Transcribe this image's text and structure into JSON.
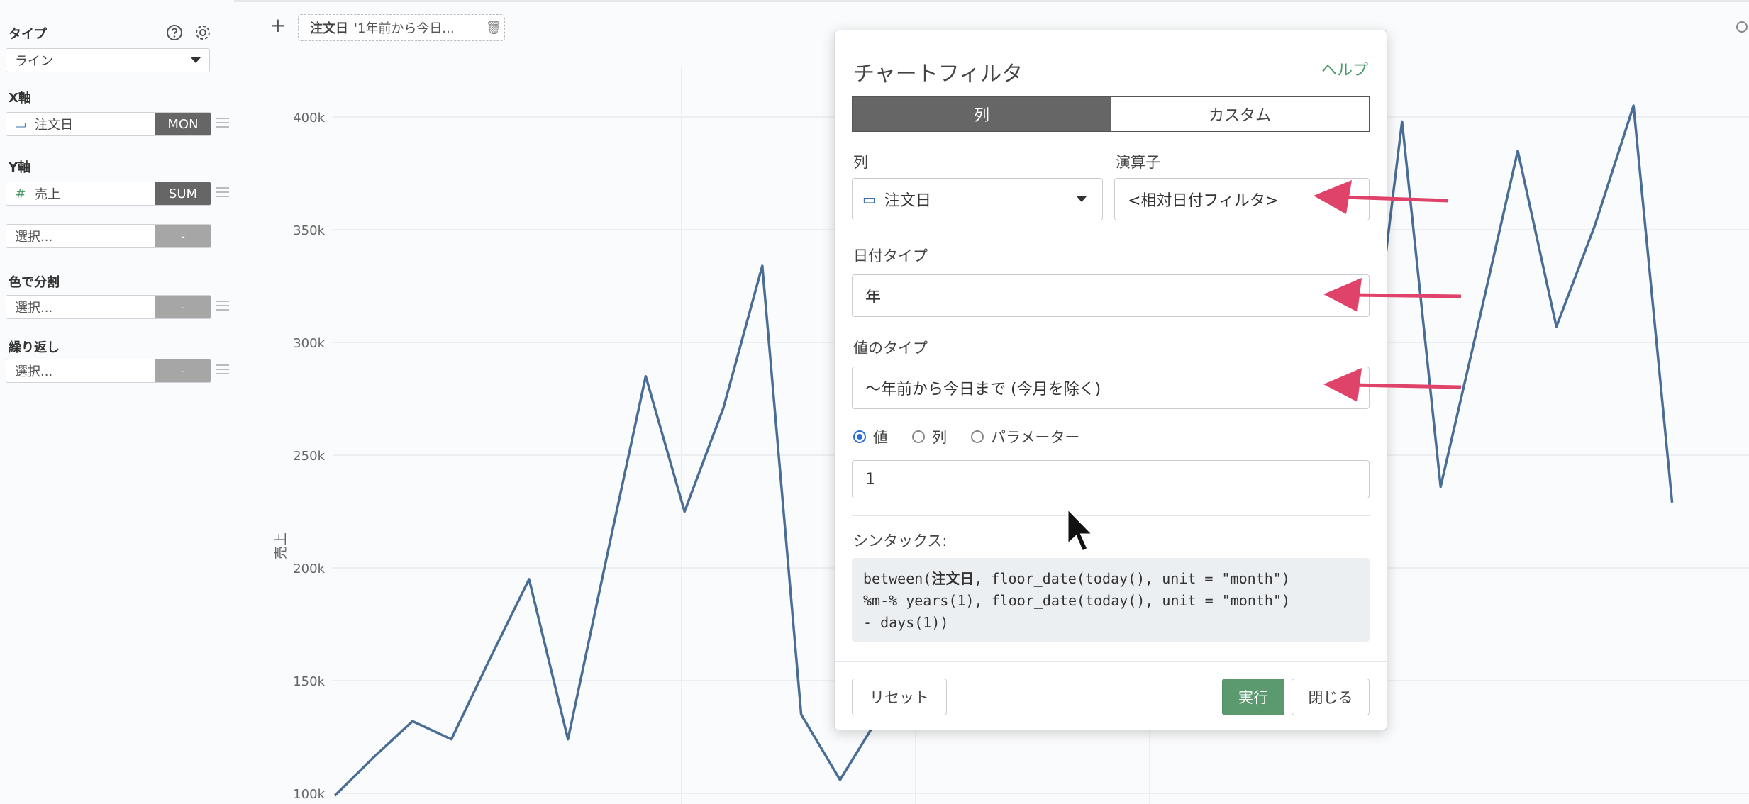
{
  "sidebar": {
    "type_label": "タイプ",
    "type_value": "ライン",
    "x_axis_label": "X軸",
    "x_field": {
      "name": "注文日",
      "agg": "MON"
    },
    "y_axis_label": "Y軸",
    "y_field": {
      "name": "売上",
      "agg": "SUM"
    },
    "y_extra": {
      "placeholder": "選択...",
      "agg": "-"
    },
    "color_label": "色で分割",
    "color_select": {
      "placeholder": "選択...",
      "agg": "-"
    },
    "repeat_label": "繰り返し",
    "repeat_select": {
      "placeholder": "選択...",
      "agg": "-"
    },
    "icons": [
      "help-icon",
      "gear-icon",
      "calendar-icon",
      "hash-icon",
      "hamburger-icon"
    ]
  },
  "toolbar": {
    "filter_chip": {
      "field": "注文日",
      "value": "'1年前から今日..."
    }
  },
  "chart_data": {
    "type": "line",
    "ylabel": "売上",
    "yticks": [
      "100k",
      "150k",
      "200k",
      "250k",
      "300k",
      "350k",
      "400k"
    ],
    "ylim": [
      100000,
      400000
    ],
    "line_color": "#4a6d96",
    "grid": true,
    "series": [
      {
        "values": [
          99000,
          116000,
          132000,
          124000,
          160000,
          195000,
          124000,
          205000,
          285000,
          225000,
          271000,
          334000,
          135000,
          106000,
          134000
        ]
      },
      {
        "values": [
          190000,
          258000,
          398000,
          236000,
          310000,
          385000,
          307000,
          352000,
          405000,
          229000
        ]
      }
    ]
  },
  "dialog": {
    "title": "チャートフィルタ",
    "help": "ヘルプ",
    "tabs": [
      {
        "label": "列",
        "active": true
      },
      {
        "label": "カスタム",
        "active": false
      }
    ],
    "column_label": "列",
    "column_value": "注文日",
    "operator_label": "演算子",
    "operator_value": "<相対日付フィルタ>",
    "date_type_label": "日付タイプ",
    "date_type_value": "年",
    "value_type_label": "値のタイプ",
    "value_type_value": "〜年前から今日まで (今月を除く)",
    "radio_options": [
      {
        "label": "値",
        "checked": true
      },
      {
        "label": "列",
        "checked": false
      },
      {
        "label": "パラメーター",
        "checked": false
      }
    ],
    "value_input": "1",
    "syntax_label": "シンタックス:",
    "syntax_lines": [
      {
        "pre": "between(",
        "bold": "注文日",
        "post": ", floor_date(today(), unit = \"month\")"
      },
      {
        "pre": "%m-% years(1), floor_date(today(), unit = \"month\")",
        "bold": "",
        "post": ""
      },
      {
        "pre": "- days(1))",
        "bold": "",
        "post": ""
      }
    ],
    "reset_button": "リセット",
    "run_button": "実行",
    "close_button": "閉じる"
  },
  "colors": {
    "accent": "#4c9a6a",
    "arrow": "#e0436a",
    "radio": "#2d6cdf",
    "primary_button": "#5a9a6e"
  }
}
